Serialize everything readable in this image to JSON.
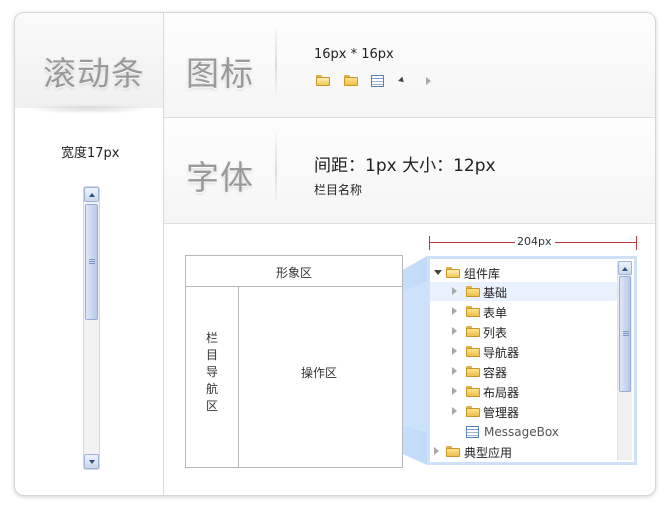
{
  "sections": {
    "scrollbar": {
      "title": "滚动条",
      "width_label": "宽度17px"
    },
    "icons": {
      "title": "图标",
      "size_label": "16px * 16px"
    },
    "font": {
      "title": "字体",
      "spec_label": "间距：1px  大小：12px",
      "sample_label": "栏目名称"
    }
  },
  "layout_diagram": {
    "top_label": "形象区",
    "nav_label": "栏\n目\n导\n航\n区",
    "nav_chars": [
      "栏",
      "目",
      "导",
      "航",
      "区"
    ],
    "main_label": "操作区",
    "tree_width_label": "204px"
  },
  "tree": {
    "root_label": "组件库",
    "children": [
      "基础",
      "表单",
      "列表",
      "导航器",
      "容器",
      "布局器",
      "管理器"
    ],
    "leaf_label": "MessageBox",
    "sibling_label": "典型应用",
    "selected_index": 0
  },
  "colors": {
    "accent_blue": "#cfe1f8",
    "dimension_red": "#c23a3a",
    "title_gray": "#9a9a9a"
  },
  "icons": [
    "folder-open-icon",
    "folder-icon",
    "grid-icon",
    "expanded-arrow-icon",
    "collapsed-arrow-icon"
  ]
}
